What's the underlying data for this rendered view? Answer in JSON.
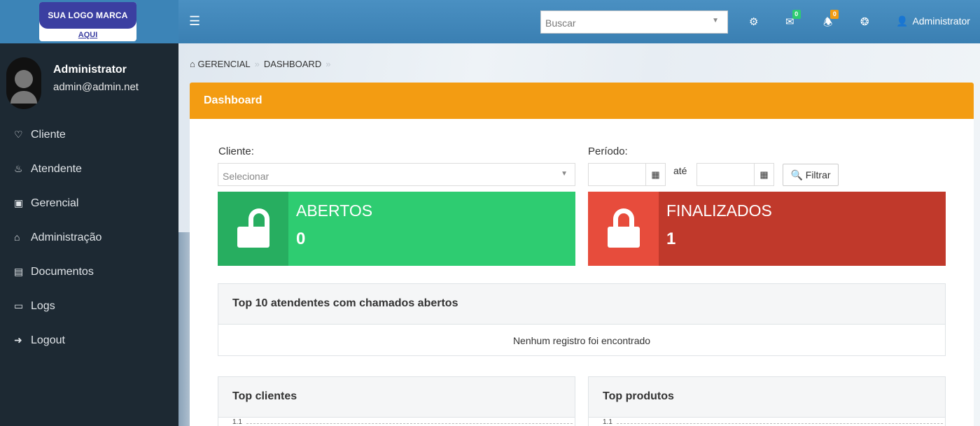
{
  "logo": {
    "line1": "SUA LOGO MARCA",
    "line2": "AQUI"
  },
  "topbar": {
    "search_placeholder": "Buscar",
    "messages_count": "0",
    "notifications_count": "0",
    "user_name": "Administrator"
  },
  "profile": {
    "name": "Administrator",
    "email": "admin@admin.net"
  },
  "menu": [
    {
      "label": "Cliente",
      "icon": "bell-outline-icon"
    },
    {
      "label": "Atendente",
      "icon": "bell-icon"
    },
    {
      "label": "Gerencial",
      "icon": "briefcase-icon"
    },
    {
      "label": "Administração",
      "icon": "home-icon"
    },
    {
      "label": "Documentos",
      "icon": "document-icon"
    },
    {
      "label": "Logs",
      "icon": "monitor-icon"
    },
    {
      "label": "Logout",
      "icon": "sign-out-icon"
    }
  ],
  "breadcrumb": {
    "item1": "GERENCIAL",
    "item2": "DASHBOARD"
  },
  "panel": {
    "title": "Dashboard"
  },
  "filters": {
    "client_label": "Cliente:",
    "client_placeholder": "Selecionar",
    "period_label": "Período:",
    "until_label": "até",
    "filter_button": "Filtrar"
  },
  "stats": {
    "open": {
      "label": "ABERTOS",
      "value": "0",
      "color": "#2ecc71",
      "icon_bg": "#27ae60"
    },
    "closed": {
      "label": "FINALIZADOS",
      "value": "1",
      "color": "#c0392b",
      "icon_bg": "#e74c3c"
    }
  },
  "top_attendants": {
    "title": "Top 10 atendentes com chamados abertos",
    "empty": "Nenhum registro foi encontrado"
  },
  "top_clients": {
    "title": "Top clientes",
    "tick": "1.1"
  },
  "top_products": {
    "title": "Top produtos",
    "tick": "1.1"
  }
}
